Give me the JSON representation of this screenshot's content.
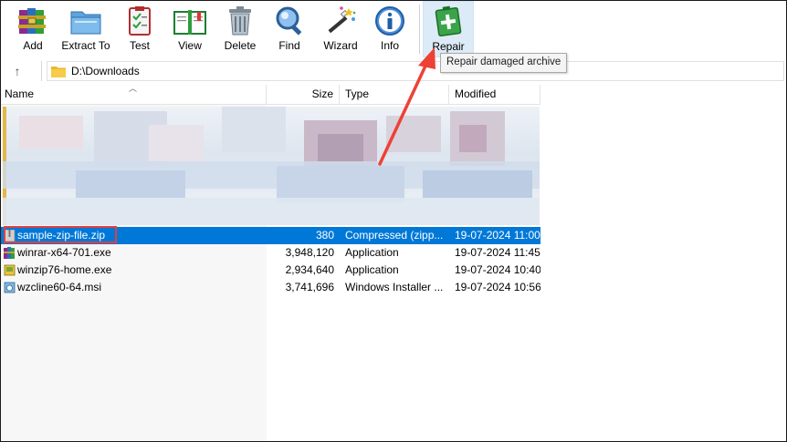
{
  "toolbar": {
    "buttons": [
      {
        "label": "Add",
        "icon": "winrar-books-icon"
      },
      {
        "label": "Extract To",
        "icon": "folder-extract-icon"
      },
      {
        "label": "Test",
        "icon": "clipboard-check-icon"
      },
      {
        "label": "View",
        "icon": "open-book-icon"
      },
      {
        "label": "Delete",
        "icon": "trash-can-icon"
      },
      {
        "label": "Find",
        "icon": "magnifier-icon"
      },
      {
        "label": "Wizard",
        "icon": "magic-wand-icon"
      },
      {
        "label": "Info",
        "icon": "info-icon"
      },
      {
        "label": "Repair",
        "icon": "first-aid-kit-icon"
      }
    ],
    "tooltip": "Repair damaged archive"
  },
  "address": {
    "path": "D:\\Downloads",
    "up_icon": "↑"
  },
  "columns": {
    "name": "Name",
    "size": "Size",
    "type": "Type",
    "modified": "Modified"
  },
  "files": [
    {
      "name": "sample-zip-file.zip",
      "size": "380",
      "type": "Compressed (zipp...",
      "modified": "19-07-2024 11:00",
      "icon": "zip-file-icon",
      "selected": true
    },
    {
      "name": "winrar-x64-701.exe",
      "size": "3,948,120",
      "type": "Application",
      "modified": "19-07-2024 11:45",
      "icon": "winrar-exe-icon",
      "selected": false
    },
    {
      "name": "winzip76-home.exe",
      "size": "2,934,640",
      "type": "Application",
      "modified": "19-07-2024 10:40",
      "icon": "winzip-exe-icon",
      "selected": false
    },
    {
      "name": "wzcline60-64.msi",
      "size": "3,741,696",
      "type": "Windows Installer ...",
      "modified": "19-07-2024 10:56",
      "icon": "msi-installer-icon",
      "selected": false
    }
  ],
  "colors": {
    "selection": "#0078d7",
    "highlight_box": "#e04040",
    "arrow": "#ee4136",
    "repair_button_bg": "#dcebf7"
  }
}
